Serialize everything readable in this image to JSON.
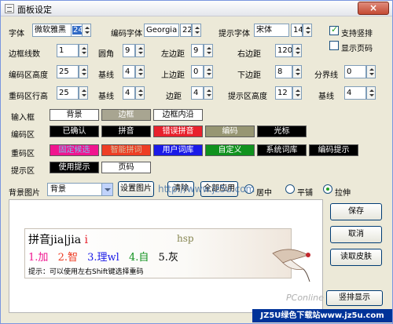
{
  "window": {
    "title": "面板设定",
    "close": "×"
  },
  "fonts": {
    "font_label": "字体",
    "font_value": "微软雅黑",
    "font_size": "24",
    "code_font_label": "编码字体",
    "code_font_value": "Georgia",
    "code_font_size": "22",
    "hint_font_label": "提示字体",
    "hint_font_value": "宋体",
    "hint_font_size": "14"
  },
  "checks": {
    "vertical": "支持竖排",
    "page_no": "显示页码"
  },
  "row2": {
    "border_label": "边框线数",
    "border_value": "1",
    "corner_label": "圆角",
    "corner_value": "9",
    "left_label": "左边距",
    "left_value": "9",
    "right_label": "右边距",
    "right_value": "120"
  },
  "row3": {
    "code_height_label": "编码区高度",
    "code_height_value": "25",
    "baseline_label": "基线",
    "baseline_value": "4",
    "top_label": "上边距",
    "top_value": "0",
    "bottom_label": "下边距",
    "bottom_value": "8",
    "divider_label": "分界线",
    "divider_value": "0"
  },
  "row4": {
    "cand_height_label": "重码区行高",
    "cand_height_value": "25",
    "baseline_label": "基线",
    "baseline_value": "4",
    "spacing_label": "边距",
    "spacing_value": "4",
    "hint_height_label": "提示区高度",
    "hint_height_value": "12",
    "baseline2_label": "基线",
    "baseline2_value": "4"
  },
  "colors": {
    "input_box_label": "输入框",
    "input_box": [
      "背景",
      "边框",
      "边框内沿"
    ],
    "code_area_label": "编码区",
    "code_area": [
      "已确认",
      "拼音",
      "错误拼音",
      "编码",
      "光标"
    ],
    "cand_area_label": "重码区",
    "cand_area": [
      "固定候选",
      "智能拼词",
      "用户词库",
      "自定义",
      "系统词库",
      "编码提示"
    ],
    "hint_area_label": "提示区",
    "hint_area": [
      "使用提示",
      "页码"
    ]
  },
  "background": {
    "label": "背景图片",
    "value": "背景",
    "set_button": "设置图片",
    "clear_button": "清除",
    "apply_all_button": "全部应用",
    "modes": [
      "居中",
      "平铺",
      "拉伸"
    ],
    "selected_mode": "拉伸"
  },
  "overlay_url": "http://www.jz5u.com",
  "preview": {
    "composition": "拼音jia|jia",
    "composition_cursor_char": "i",
    "code_hint": "hsp",
    "candidates": [
      {
        "index": "1.",
        "text": "加"
      },
      {
        "index": "2.",
        "text": "智"
      },
      {
        "index": "3.",
        "text": "理wl"
      },
      {
        "index": "4.",
        "text": "自"
      },
      {
        "index": "5.",
        "text": "灰"
      }
    ],
    "tip": "提示：可以使用左右Shift键选择重码",
    "brand": "PConline"
  },
  "buttons": {
    "save": "保存",
    "cancel": "取消",
    "load_skin": "读取皮肤",
    "vertical_preview": "竖排显示"
  },
  "footer_watermark": "JZ5U绿色下载站www.jz5u.com",
  "accent": {
    "title_bar": "#e4e6ec",
    "selection": "#316ac5",
    "close": "#c44a33"
  }
}
